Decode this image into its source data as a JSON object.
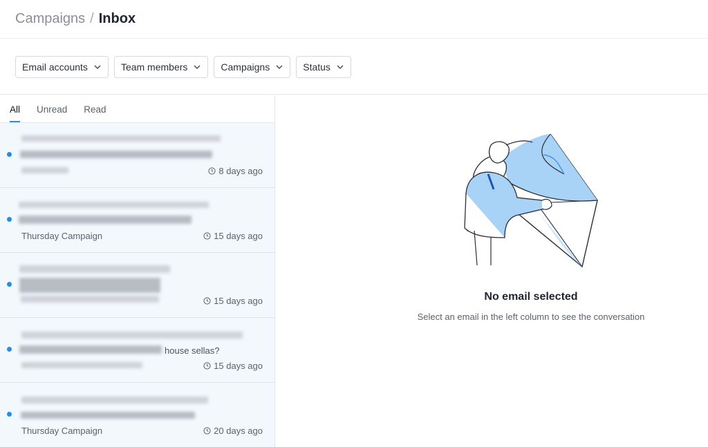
{
  "breadcrumb": {
    "root": "Campaigns",
    "separator": "/",
    "current": "Inbox"
  },
  "filters": [
    {
      "label": "Email accounts"
    },
    {
      "label": "Team members"
    },
    {
      "label": "Campaigns"
    },
    {
      "label": "Status"
    }
  ],
  "tabs": [
    {
      "label": "All",
      "active": true
    },
    {
      "label": "Unread",
      "active": false
    },
    {
      "label": "Read",
      "active": false
    }
  ],
  "emails": [
    {
      "campaign": "",
      "time": "8 days ago",
      "unread": true
    },
    {
      "campaign": "Thursday Campaign",
      "time": "15 days ago",
      "unread": true
    },
    {
      "campaign": "",
      "time": "15 days ago",
      "unread": true
    },
    {
      "campaign": "",
      "time": "15 days ago",
      "unread": true,
      "visible_fragment": "house sellas?"
    },
    {
      "campaign": "Thursday Campaign",
      "time": "20 days ago",
      "unread": true
    }
  ],
  "empty_state": {
    "title": "No email selected",
    "subtitle": "Select an email in the left column to see the conversation",
    "illustration": "person-reading-envelope-illustration"
  },
  "colors": {
    "accent": "#2f8be6",
    "unread_dot": "#2a8ae4",
    "list_bg": "#f3f8fd",
    "illustration_blue": "#a9d2f7"
  }
}
